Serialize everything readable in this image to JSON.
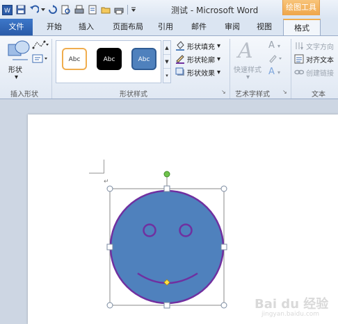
{
  "title_bar": {
    "doc_title": "测试 - Microsoft Word",
    "context_label": "绘图工具",
    "qat_icons": [
      "word-app-icon",
      "save-icon",
      "undo-icon",
      "redo-icon",
      "print-preview-icon",
      "print-icon",
      "new-doc-icon",
      "open-icon",
      "quick-print-icon",
      "customize-qat-icon"
    ]
  },
  "tabs": {
    "file": "文件",
    "items": [
      "开始",
      "插入",
      "页面布局",
      "引用",
      "邮件",
      "审阅",
      "视图"
    ],
    "active": "格式"
  },
  "ribbon": {
    "insert_shapes": {
      "shapes_label": "形状",
      "group_label": "插入形状"
    },
    "shape_styles": {
      "presets": [
        "Abc",
        "Abc",
        "Abc"
      ],
      "fill_label": "形状填充",
      "outline_label": "形状轮廓",
      "effects_label": "形状效果",
      "group_label": "形状样式"
    },
    "wordart": {
      "quick_styles_label": "快速样式",
      "group_label": "艺术字样式"
    },
    "text": {
      "direction_label": "文字方向",
      "align_label": "对齐文本",
      "link_label": "创建链接",
      "group_label": "文本"
    }
  },
  "colors": {
    "face_fill": "#4f81bd",
    "face_outline": "#7030a0",
    "accent_orange": "#f0ad4e",
    "rotate_handle": "#6fc34b",
    "adjust_handle": "#ffe14a"
  },
  "watermark": {
    "text": "Bai du 经验",
    "sub": "jingyan.baidu.com"
  }
}
